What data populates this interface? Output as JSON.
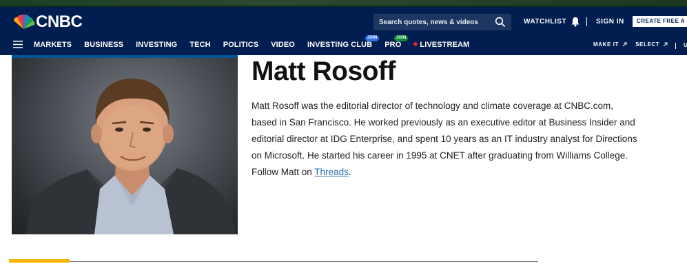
{
  "brand": {
    "logo_text": "CNBC"
  },
  "search": {
    "placeholder": "Search quotes, news & videos"
  },
  "header": {
    "watchlist_label": "WATCHLIST",
    "signin_label": "SIGN IN",
    "create_label": "CREATE FREE A"
  },
  "nav": {
    "items": [
      {
        "label": "MARKETS"
      },
      {
        "label": "BUSINESS"
      },
      {
        "label": "INVESTING"
      },
      {
        "label": "TECH"
      },
      {
        "label": "POLITICS"
      },
      {
        "label": "VIDEO"
      },
      {
        "label": "INVESTING CLUB",
        "badge": "JOIN"
      },
      {
        "label": "PRO",
        "badge": "JOIN"
      },
      {
        "label": "LIVESTREAM"
      }
    ],
    "right": [
      {
        "label": "MAKE IT"
      },
      {
        "label": "SELECT"
      }
    ],
    "right_trailing": "U"
  },
  "profile": {
    "name": "Matt Rosoff",
    "bio_lines": [
      "Matt Rosoff was the editorial director of technology and climate coverage at CNBC.com,",
      "based in San Francisco. He worked previously as an executive editor at Business Insider and",
      "editorial director at IDG Enterprise, and spent 10 years as an IT industry analyst for Directions",
      "on Microsoft. He started his career in 1995 at CNET after graduating from Williams College."
    ],
    "follow_prefix": "Follow Matt on ",
    "follow_link": "Threads",
    "follow_suffix": "."
  },
  "colors": {
    "header_bg": "#001e50",
    "accent_yellow": "#f7b500",
    "link_blue": "#2a6fb0",
    "photo_border": "#005594"
  }
}
